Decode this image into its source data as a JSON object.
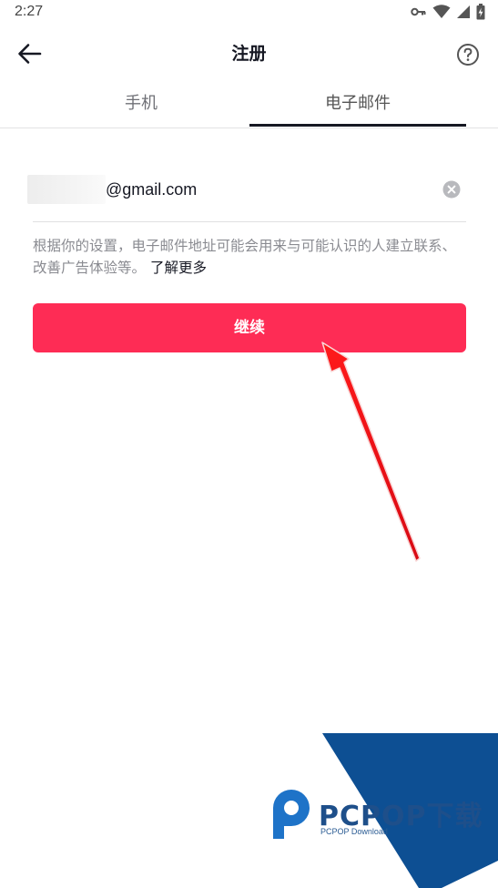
{
  "status_bar": {
    "time": "2:27"
  },
  "header": {
    "title": "注册",
    "back_icon": "arrow-left-icon",
    "help_icon": "question-circle-icon"
  },
  "tabs": [
    {
      "label": "手机",
      "selected": false
    },
    {
      "label": "电子邮件",
      "selected": true
    }
  ],
  "email_field": {
    "value": "@gmail.com",
    "clear_icon": "clear-circle-icon"
  },
  "hint": {
    "text": "根据你的设置，电子邮件地址可能会用来与可能认识的人建立联系、改善广告体验等。",
    "link_label": "了解更多"
  },
  "continue_button": {
    "label": "继续"
  },
  "watermark": {
    "title": "PCPOP下载",
    "subtitle": "PCPOP Download"
  },
  "colors": {
    "accent": "#fe2c55",
    "text_primary": "#161823",
    "text_secondary": "#8a8b91",
    "arrow": "#e8101a",
    "watermark_blue": "#0d4f93"
  }
}
